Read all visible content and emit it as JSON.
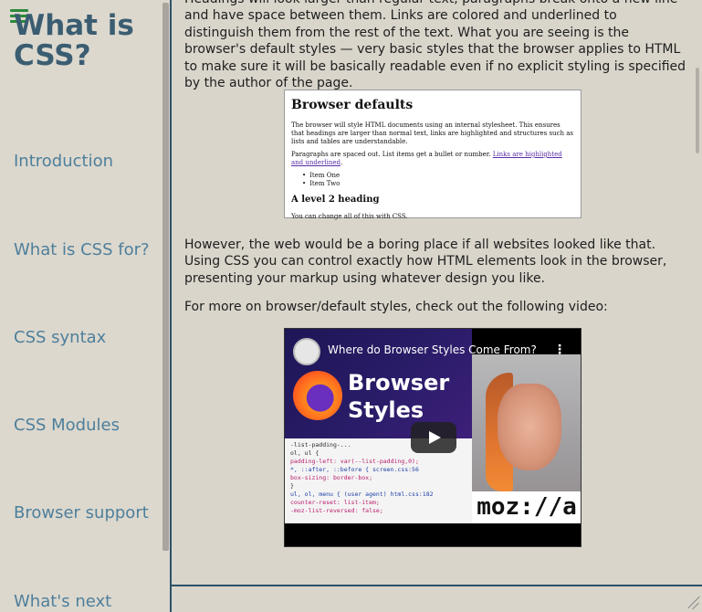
{
  "sidebar": {
    "title": "What is CSS?",
    "items": [
      {
        "label": "Introduction"
      },
      {
        "label": "What is CSS for?"
      },
      {
        "label": "CSS syntax"
      },
      {
        "label": "CSS Modules"
      },
      {
        "label": "Browser support"
      },
      {
        "label": "What's next"
      }
    ]
  },
  "main": {
    "intro_text": "Headings will look larger than regular text, paragraphs break onto a new line and have space between them. Links are colored and underlined to distinguish them from the rest of the text. What you are seeing is the browser's default styles — very basic styles that the browser applies to HTML to make sure it will be basically readable even if no explicit styling is specified by the author of the page.",
    "browser_defaults": {
      "heading": "Browser defaults",
      "para1": "The browser will style HTML documents using an internal stylesheet. This ensures that headings are larger than normal text, links are highlighted and structures such as lists and tables are understandable.",
      "para2_prefix": "Paragraphs are spaced out. List items get a bullet or number.",
      "para2_link": "Links are highlighted and underlined",
      "list": [
        "Item One",
        "Item Two"
      ],
      "heading2": "A level 2 heading",
      "para3": "You can change all of this with CSS."
    },
    "however_text": "However, the web would be a boring place if all websites looked like that. Using CSS you can control exactly how HTML elements look in the browser, presenting your markup using whatever design you like.",
    "more_text": "For more on browser/default styles, check out the following video:",
    "video": {
      "title": "Where do Browser Styles Come From?",
      "thumb_line1": "Browser",
      "thumb_line2": "Styles",
      "brand": "moz://a",
      "code_lines": [
        "-list-padding-...",
        "ol, ul {",
        "  padding-left: var(--list-padding,0);",
        "*, ::after, ::before {       screen.css:56",
        "  box-sizing: border-box;",
        "}",
        "ul, ol, menu {      (user agent) html.css:182",
        "  counter-reset: list-item;",
        "  -moz-list-reversed: false;"
      ]
    }
  }
}
